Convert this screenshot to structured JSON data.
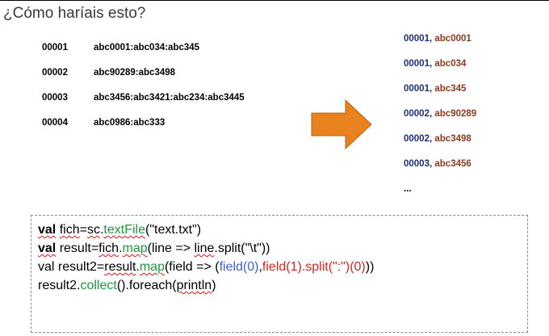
{
  "heading": "¿Cómo haríais esto?",
  "input_rows": [
    {
      "id": "00001",
      "value": "abc0001:abc034:abc345"
    },
    {
      "id": "00002",
      "value": "abc90289:abc3498"
    },
    {
      "id": "00003",
      "value": "abc3456:abc3421:abc234:abc3445"
    },
    {
      "id": "00004",
      "value": "abc0986:abc333"
    }
  ],
  "arrow": {
    "icon": "arrow-right-icon",
    "color": "#e8821e"
  },
  "output_rows": [
    {
      "id": "00001",
      "sep": ", ",
      "value": "abc0001"
    },
    {
      "id": "00001",
      "sep": ", ",
      "value": "abc034"
    },
    {
      "id": "00001",
      "sep": ", ",
      "value": "abc345"
    },
    {
      "id": "00002",
      "sep": ", ",
      "value": "abc90289"
    },
    {
      "id": "00002",
      "sep": ", ",
      "value": "abc3498"
    },
    {
      "id": "00003",
      "sep": ", ",
      "value": "abc3456"
    }
  ],
  "output_ellipsis": "...",
  "code": {
    "l1": {
      "kw": "val",
      "a": " ",
      "b": "fich",
      "c": "=",
      "d": "sc",
      "e": ".",
      "f": "textFile",
      "g": "(\"text.txt\")"
    },
    "l2": {
      "kw": "val",
      "a": " result=",
      "b": "fich",
      "c": ".",
      "d": "map",
      "e": "(line => ",
      "f": "line",
      "g": ".split(\"\\t\"))"
    },
    "l3": {
      "a": "val result2=",
      "b": "result",
      "c": ".",
      "d": "map",
      "e": "(field => (",
      "f": "field(0)",
      "g": ",",
      "h": "field(1).split(\":\")(0)",
      "i": "))"
    },
    "l4": {
      "a": "result2.",
      "b": "collect",
      "c": "().foreach(",
      "d": "println",
      "e": ")"
    }
  }
}
